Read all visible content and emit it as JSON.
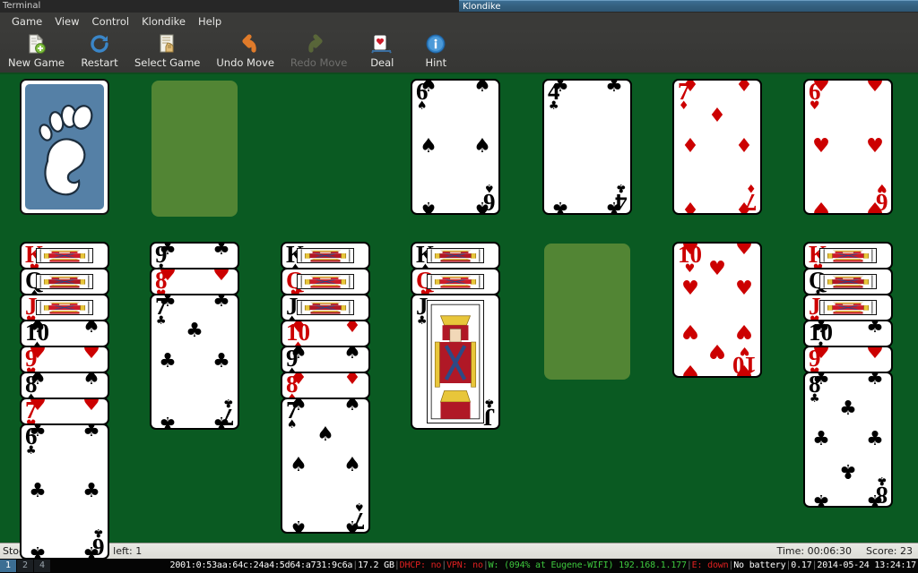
{
  "window": {
    "terminal_title": "Terminal",
    "active_title": "Klondike"
  },
  "menu": {
    "items": [
      "Game",
      "View",
      "Control",
      "Klondike",
      "Help"
    ]
  },
  "toolbar": {
    "buttons": [
      {
        "label": "New Game",
        "icon": "new-document-icon",
        "disabled": false
      },
      {
        "label": "Restart",
        "icon": "restart-refresh-icon",
        "disabled": false
      },
      {
        "label": "Select Game",
        "icon": "select-game-icon",
        "disabled": false
      },
      {
        "label": "Undo Move",
        "icon": "undo-arrow-icon",
        "disabled": false
      },
      {
        "label": "Redo Move",
        "icon": "redo-arrow-icon",
        "disabled": true
      },
      {
        "label": "Deal",
        "icon": "deal-card-icon",
        "disabled": false
      },
      {
        "label": "Hint",
        "icon": "info-hint-icon",
        "disabled": false
      }
    ]
  },
  "status": {
    "stock_left_label": "Stock left:",
    "stock_left_value": "1",
    "redeals_left_label": "Redeals left:",
    "redeals_left_value": "1",
    "time_label": "Time:",
    "time_value": "00:06:30",
    "score_label": "Score:",
    "score_value": "23"
  },
  "taskbar": {
    "workspaces": [
      {
        "label": "1",
        "active": true
      },
      {
        "label": "2",
        "active": false
      },
      {
        "label": "4",
        "active": false
      }
    ],
    "ipv6": "2001:0:53aa:64c:24a4:5d64:a731:9c6a",
    "memory": "17.2 GB",
    "dhcp_label": "DHCP:",
    "dhcp_value": "no",
    "vpn_label": "VPN:",
    "vpn_value": "no",
    "wifi_label": "W:",
    "wifi_value": "(094% at Eugene-WIFI) 192.168.1.177",
    "eth_label": "E:",
    "eth_value": "down",
    "battery": "No battery",
    "load": "0.17",
    "datetime": "2014-05-24 13:24:17"
  },
  "board": {
    "stock": {
      "type": "facedown",
      "icon": "gnome-foot-card-back",
      "back_color": "#5580a6"
    },
    "waste": {
      "type": "empty-slot"
    },
    "foundations": [
      {
        "rank": "6",
        "suit": "spades",
        "color": "#000000"
      },
      {
        "rank": "4",
        "suit": "clubs",
        "color": "#000000"
      },
      {
        "rank": "7",
        "suit": "diamonds",
        "color": "#cc0000"
      },
      {
        "rank": "6",
        "suit": "hearts",
        "color": "#cc0000"
      }
    ],
    "tableau": [
      {
        "column": 1,
        "cards": [
          {
            "rank": "K",
            "suit": "hearts",
            "color": "#cc0000",
            "face": "court"
          },
          {
            "rank": "Q",
            "suit": "spades",
            "color": "#000000",
            "face": "court"
          },
          {
            "rank": "J",
            "suit": "hearts",
            "color": "#cc0000",
            "face": "court"
          },
          {
            "rank": "10",
            "suit": "spades",
            "color": "#000000",
            "face": "pip"
          },
          {
            "rank": "9",
            "suit": "hearts",
            "color": "#cc0000",
            "face": "pip"
          },
          {
            "rank": "8",
            "suit": "spades",
            "color": "#000000",
            "face": "pip"
          },
          {
            "rank": "7",
            "suit": "hearts",
            "color": "#cc0000",
            "face": "pip"
          },
          {
            "rank": "6",
            "suit": "clubs",
            "color": "#000000",
            "face": "pip"
          }
        ]
      },
      {
        "column": 2,
        "cards": [
          {
            "rank": "9",
            "suit": "clubs",
            "color": "#000000",
            "face": "pip"
          },
          {
            "rank": "8",
            "suit": "hearts",
            "color": "#cc0000",
            "face": "pip"
          },
          {
            "rank": "7",
            "suit": "clubs",
            "color": "#000000",
            "face": "pip"
          }
        ]
      },
      {
        "column": 3,
        "cards": [
          {
            "rank": "K",
            "suit": "spades",
            "color": "#000000",
            "face": "court"
          },
          {
            "rank": "Q",
            "suit": "hearts",
            "color": "#cc0000",
            "face": "court"
          },
          {
            "rank": "J",
            "suit": "spades",
            "color": "#000000",
            "face": "court"
          },
          {
            "rank": "10",
            "suit": "diamonds",
            "color": "#cc0000",
            "face": "pip"
          },
          {
            "rank": "9",
            "suit": "spades",
            "color": "#000000",
            "face": "pip"
          },
          {
            "rank": "8",
            "suit": "diamonds",
            "color": "#cc0000",
            "face": "pip"
          },
          {
            "rank": "7",
            "suit": "spades",
            "color": "#000000",
            "face": "pip"
          }
        ]
      },
      {
        "column": 4,
        "cards": [
          {
            "rank": "K",
            "suit": "spades",
            "color": "#000000",
            "face": "court"
          },
          {
            "rank": "Q",
            "suit": "hearts",
            "color": "#cc0000",
            "face": "court"
          },
          {
            "rank": "J",
            "suit": "clubs",
            "color": "#000000",
            "face": "court"
          }
        ]
      },
      {
        "column": 5,
        "cards": []
      },
      {
        "column": 6,
        "cards": [
          {
            "rank": "10",
            "suit": "hearts",
            "color": "#cc0000",
            "face": "pip"
          }
        ]
      },
      {
        "column": 7,
        "cards": [
          {
            "rank": "K",
            "suit": "hearts",
            "color": "#cc0000",
            "face": "court"
          },
          {
            "rank": "Q",
            "suit": "clubs",
            "color": "#000000",
            "face": "court"
          },
          {
            "rank": "J",
            "suit": "hearts",
            "color": "#cc0000",
            "face": "court"
          },
          {
            "rank": "10",
            "suit": "clubs",
            "color": "#000000",
            "face": "pip"
          },
          {
            "rank": "9",
            "suit": "hearts",
            "color": "#cc0000",
            "face": "pip"
          },
          {
            "rank": "8",
            "suit": "clubs",
            "color": "#000000",
            "face": "pip"
          }
        ]
      }
    ]
  },
  "theme": {
    "table_green": "#0a5a22",
    "slot_green": "#5c8b37",
    "titlebar_active": "#34607f",
    "chrome_dark": "#3a3a38"
  }
}
